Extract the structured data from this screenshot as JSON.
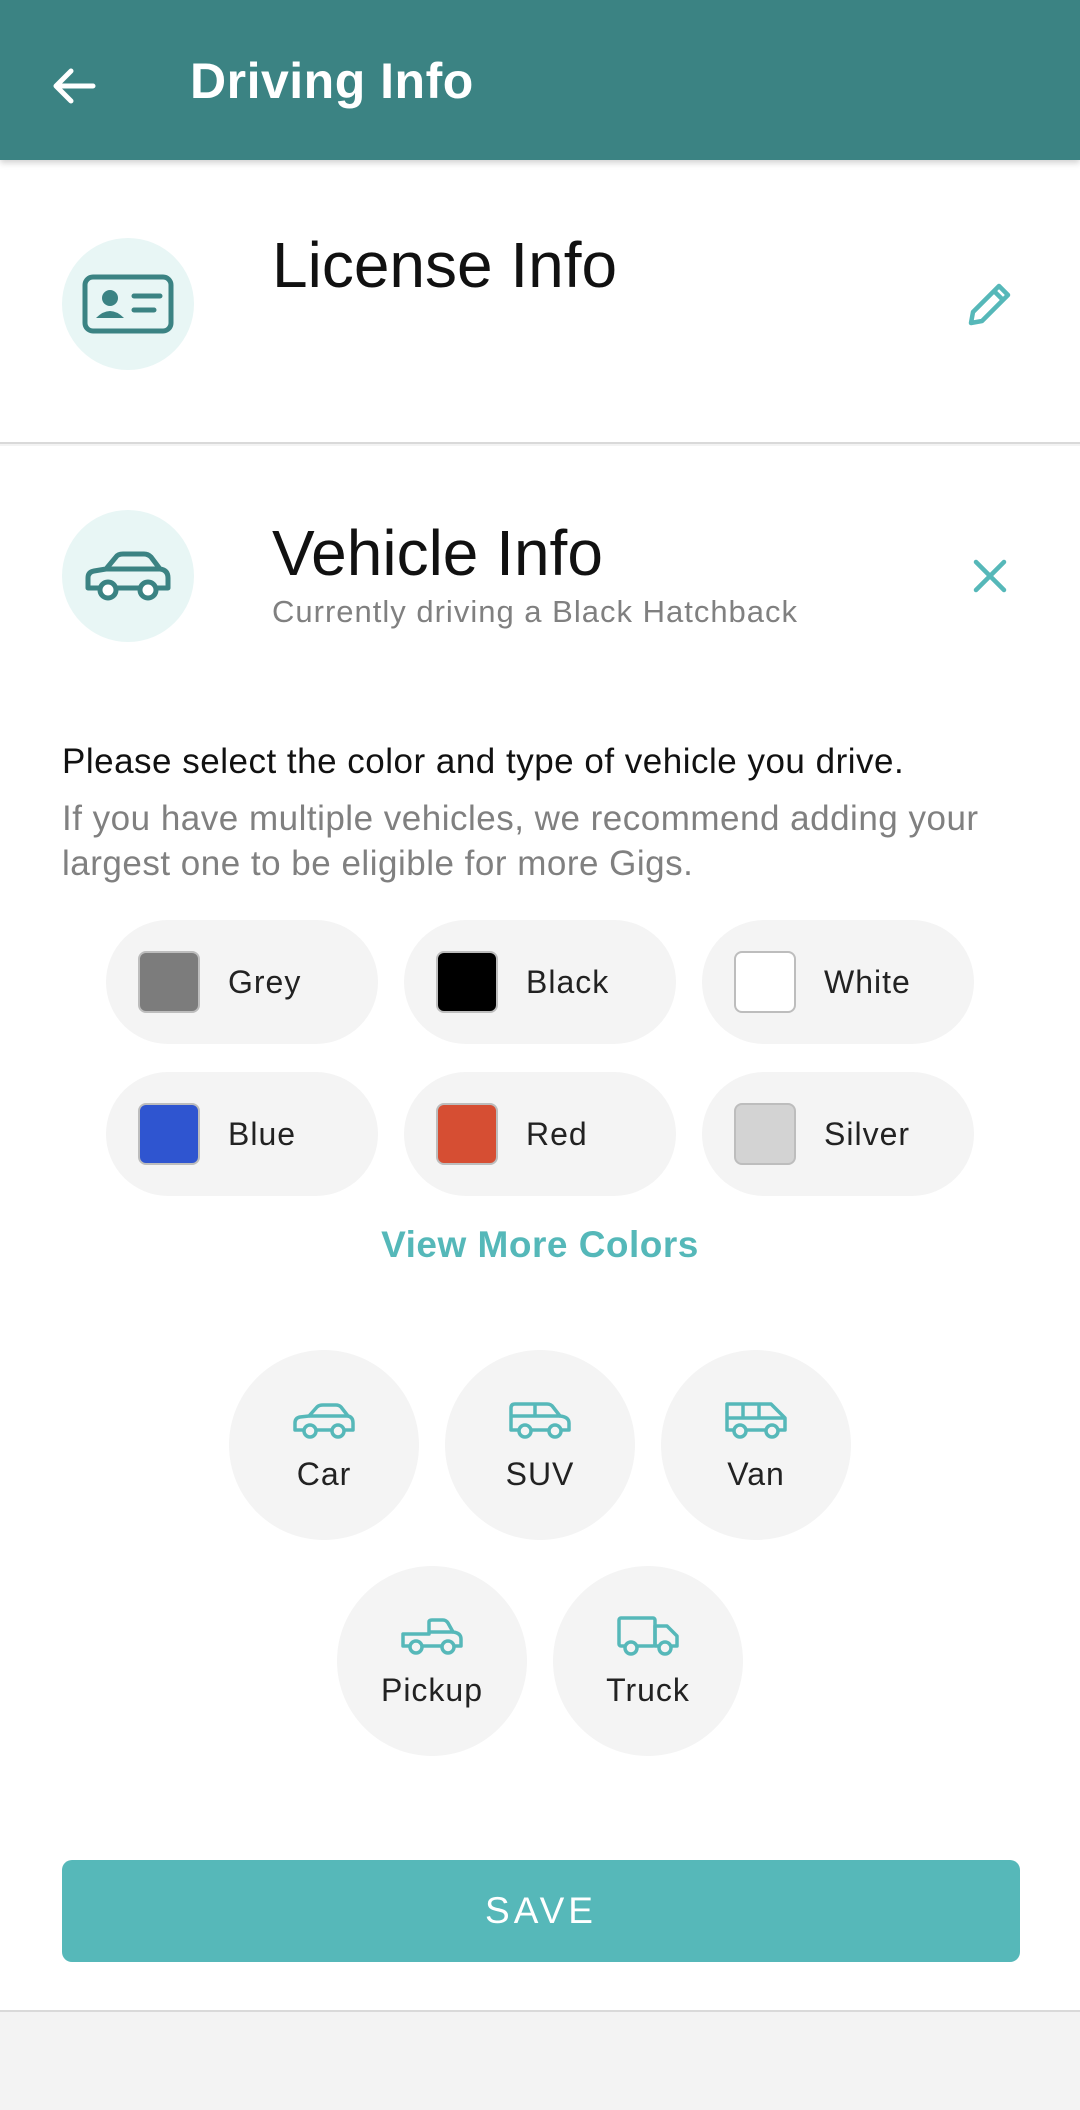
{
  "appbar": {
    "title": "Driving Info"
  },
  "license": {
    "title": "License Info"
  },
  "vehicle": {
    "title": "Vehicle Info",
    "subtitle": "Currently driving a Black Hatchback",
    "instruction": "Please select the color and type of vehicle you drive.",
    "instruction_sub": "If you have multiple vehicles, we recommend adding your largest one to be eligible for more Gigs.",
    "colors": [
      {
        "label": "Grey",
        "hex": "#7c7c7c"
      },
      {
        "label": "Black",
        "hex": "#000000"
      },
      {
        "label": "White",
        "hex": "#ffffff"
      },
      {
        "label": "Blue",
        "hex": "#2f55d0"
      },
      {
        "label": "Red",
        "hex": "#d64e33"
      },
      {
        "label": "Silver",
        "hex": "#d3d3d3"
      }
    ],
    "view_more_label": "View More Colors",
    "types": [
      {
        "label": "Car",
        "icon": "car-icon"
      },
      {
        "label": "SUV",
        "icon": "suv-icon"
      },
      {
        "label": "Van",
        "icon": "van-icon"
      },
      {
        "label": "Pickup",
        "icon": "pickup-icon"
      },
      {
        "label": "Truck",
        "icon": "truck-icon"
      }
    ],
    "save_label": "SAVE"
  },
  "theme": {
    "primary": "#3b8383",
    "accent": "#56b8b9",
    "icon_bg": "#e8f6f5",
    "chip_bg": "#f4f4f4"
  }
}
